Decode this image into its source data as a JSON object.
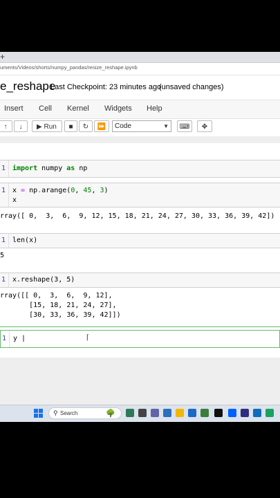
{
  "browser": {
    "new_tab": "+",
    "url": "uments/Videos/shorts/numpy_pandas/resize_reshape.ipynb"
  },
  "notebook": {
    "title": "e_reshape",
    "checkpoint": "Last Checkpoint: 23 minutes ago",
    "status": "(unsaved changes)"
  },
  "menu": [
    "Insert",
    "Cell",
    "Kernel",
    "Widgets",
    "Help"
  ],
  "toolbar": {
    "up": "🡡",
    "down": "🡣",
    "run_label": "Run",
    "cell_type": "Code"
  },
  "cells": [
    {
      "num": "1",
      "code": [
        "import numpy as np"
      ]
    },
    {
      "num": "1",
      "code": [
        "x = np.arange(0, 45, 3)",
        "x"
      ],
      "output": [
        "rray([ 0,  3,  6,  9, 12, 15, 18, 21, 24, 27, 30, 33, 36, 39, 42])"
      ]
    },
    {
      "num": "1",
      "code": [
        "len(x)"
      ],
      "output": [
        "5"
      ]
    },
    {
      "num": "1",
      "code": [
        "x.reshape(3, 5)"
      ],
      "output": [
        "rray([[ 0,  3,  6,  9, 12],",
        "       [15, 18, 21, 24, 27],",
        "       [30, 33, 36, 39, 42]])"
      ]
    },
    {
      "num": "1",
      "code": [
        "y |"
      ]
    }
  ],
  "taskbar": {
    "search_placeholder": "Search"
  },
  "colors": {
    "keyword": "#008000",
    "number": "#008000",
    "operator": "#aa22ff",
    "prompt": "#303f9f",
    "active_border": "#66bb6a"
  }
}
